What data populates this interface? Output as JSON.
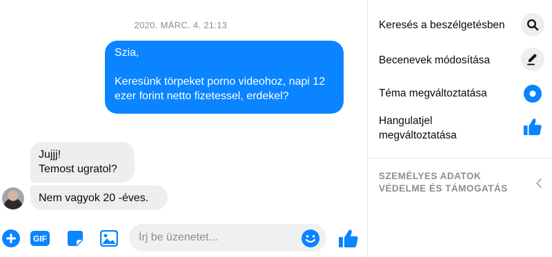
{
  "chat": {
    "timestamp": "2020. MÁRC. 4. 21:13",
    "messages": [
      {
        "direction": "outgoing",
        "text": "Szia,\n\nKeresünk törpeket porno videohoz, napi 12 ezer forint netto fizetessel, erdekel?"
      },
      {
        "direction": "incoming",
        "text": "Jujjj!\nTemost ugratol?"
      },
      {
        "direction": "incoming",
        "text": "Nem vagyok 20 -éves."
      }
    ]
  },
  "composer": {
    "placeholder": "Írj be üzenetet...",
    "gif_label": "GIF",
    "icons": [
      "plus-icon",
      "gif-icon",
      "sticker-icon",
      "image-icon",
      "emoji-icon",
      "thumbs-up-icon"
    ]
  },
  "sidebar": {
    "items": [
      {
        "label": "Keresés a beszélgetésben",
        "icon": "search-icon"
      },
      {
        "label": "Becenevek módosítása",
        "icon": "pencil-icon"
      },
      {
        "label": "Téma megváltoztatása",
        "icon": "theme-icon"
      },
      {
        "label": "Hangulatjel megváltoztatása",
        "icon": "thumbs-up-icon"
      }
    ],
    "privacy_label": "SZEMÉLYES ADATOK VÉDELME ÉS TÁMOGATÁS"
  },
  "colors": {
    "accent": "#0a84ff",
    "incoming_bubble": "#eeeef0",
    "muted_text": "#8a8d91"
  }
}
